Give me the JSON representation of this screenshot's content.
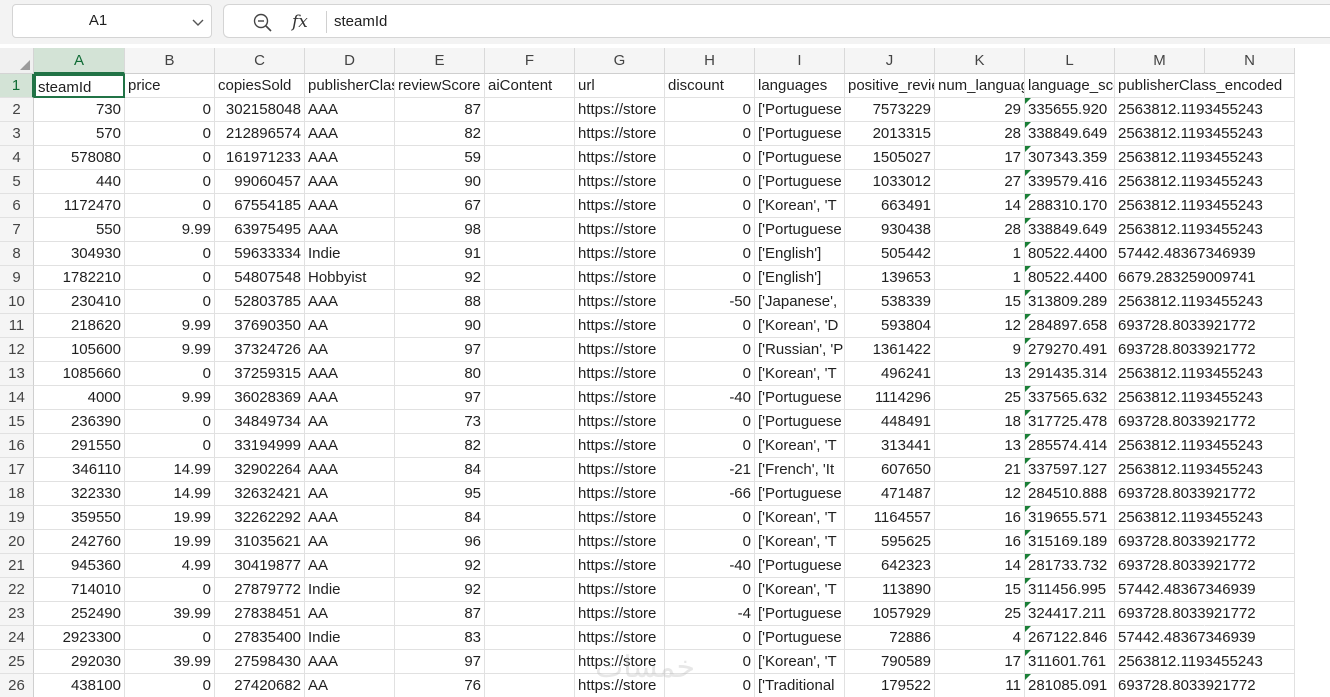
{
  "formula_bar": {
    "name_box": "A1",
    "zoom_icon": "magnifier-icon",
    "fx_label": "fx",
    "value": "steamId"
  },
  "colors": {
    "accent": "#217346",
    "header_bg": "#f5f5f5",
    "selected_header_bg": "#d3e3d6"
  },
  "columns": [
    {
      "letter": "A"
    },
    {
      "letter": "B"
    },
    {
      "letter": "C"
    },
    {
      "letter": "D"
    },
    {
      "letter": "E"
    },
    {
      "letter": "F"
    },
    {
      "letter": "G"
    },
    {
      "letter": "H"
    },
    {
      "letter": "I"
    },
    {
      "letter": "J"
    },
    {
      "letter": "K"
    },
    {
      "letter": "L"
    },
    {
      "letter": "M"
    },
    {
      "letter": "N"
    }
  ],
  "rows": [
    {
      "n": "1",
      "cells": [
        "steamId",
        "price",
        "copiesSold",
        "publisherClass",
        "reviewScore",
        "aiContent",
        "url",
        "discount",
        "languages",
        "positive_reviews",
        "num_languages",
        "language_score",
        "publisherClass_encoded"
      ]
    },
    {
      "n": "2",
      "cells": [
        "730",
        "0",
        "302158048",
        "AAA",
        "87",
        "",
        "https://store",
        "0",
        "['Portuguese",
        "7573229",
        "29",
        "335655.920",
        "2563812.1193455243"
      ]
    },
    {
      "n": "3",
      "cells": [
        "570",
        "0",
        "212896574",
        "AAA",
        "82",
        "",
        "https://store",
        "0",
        "['Portuguese",
        "2013315",
        "28",
        "338849.649",
        "2563812.1193455243"
      ]
    },
    {
      "n": "4",
      "cells": [
        "578080",
        "0",
        "161971233",
        "AAA",
        "59",
        "",
        "https://store",
        "0",
        "['Portuguese",
        "1505027",
        "17",
        "307343.359",
        "2563812.1193455243"
      ]
    },
    {
      "n": "5",
      "cells": [
        "440",
        "0",
        "99060457",
        "AAA",
        "90",
        "",
        "https://store",
        "0",
        "['Portuguese",
        "1033012",
        "27",
        "339579.416",
        "2563812.1193455243"
      ]
    },
    {
      "n": "6",
      "cells": [
        "1172470",
        "0",
        "67554185",
        "AAA",
        "67",
        "",
        "https://store",
        "0",
        "['Korean', 'T",
        "663491",
        "14",
        "288310.170",
        "2563812.1193455243"
      ]
    },
    {
      "n": "7",
      "cells": [
        "550",
        "9.99",
        "63975495",
        "AAA",
        "98",
        "",
        "https://store",
        "0",
        "['Portuguese",
        "930438",
        "28",
        "338849.649",
        "2563812.1193455243"
      ]
    },
    {
      "n": "8",
      "cells": [
        "304930",
        "0",
        "59633334",
        "Indie",
        "91",
        "",
        "https://store",
        "0",
        "['English']",
        "505442",
        "1",
        "80522.4400",
        "57442.48367346939"
      ]
    },
    {
      "n": "9",
      "cells": [
        "1782210",
        "0",
        "54807548",
        "Hobbyist",
        "92",
        "",
        "https://store",
        "0",
        "['English']",
        "139653",
        "1",
        "80522.4400",
        "6679.283259009741"
      ]
    },
    {
      "n": "10",
      "cells": [
        "230410",
        "0",
        "52803785",
        "AAA",
        "88",
        "",
        "https://store",
        "-50",
        "['Japanese',",
        "538339",
        "15",
        "313809.289",
        "2563812.1193455243"
      ]
    },
    {
      "n": "11",
      "cells": [
        "218620",
        "9.99",
        "37690350",
        "AA",
        "90",
        "",
        "https://store",
        "0",
        "['Korean', 'D",
        "593804",
        "12",
        "284897.658",
        "693728.8033921772"
      ]
    },
    {
      "n": "12",
      "cells": [
        "105600",
        "9.99",
        "37324726",
        "AA",
        "97",
        "",
        "https://store",
        "0",
        "['Russian', 'P",
        "1361422",
        "9",
        "279270.491",
        "693728.8033921772"
      ]
    },
    {
      "n": "13",
      "cells": [
        "1085660",
        "0",
        "37259315",
        "AAA",
        "80",
        "",
        "https://store",
        "0",
        "['Korean', 'T",
        "496241",
        "13",
        "291435.314",
        "2563812.1193455243"
      ]
    },
    {
      "n": "14",
      "cells": [
        "4000",
        "9.99",
        "36028369",
        "AAA",
        "97",
        "",
        "https://store",
        "-40",
        "['Portuguese",
        "1114296",
        "25",
        "337565.632",
        "2563812.1193455243"
      ]
    },
    {
      "n": "15",
      "cells": [
        "236390",
        "0",
        "34849734",
        "AA",
        "73",
        "",
        "https://store",
        "0",
        "['Portuguese",
        "448491",
        "18",
        "317725.478",
        "693728.8033921772"
      ]
    },
    {
      "n": "16",
      "cells": [
        "291550",
        "0",
        "33194999",
        "AAA",
        "82",
        "",
        "https://store",
        "0",
        "['Korean', 'T",
        "313441",
        "13",
        "285574.414",
        "2563812.1193455243"
      ]
    },
    {
      "n": "17",
      "cells": [
        "346110",
        "14.99",
        "32902264",
        "AAA",
        "84",
        "",
        "https://store",
        "-21",
        "['French', 'It",
        "607650",
        "21",
        "337597.127",
        "2563812.1193455243"
      ]
    },
    {
      "n": "18",
      "cells": [
        "322330",
        "14.99",
        "32632421",
        "AA",
        "95",
        "",
        "https://store",
        "-66",
        "['Portuguese",
        "471487",
        "12",
        "284510.888",
        "693728.8033921772"
      ]
    },
    {
      "n": "19",
      "cells": [
        "359550",
        "19.99",
        "32262292",
        "AAA",
        "84",
        "",
        "https://store",
        "0",
        "['Korean', 'T",
        "1164557",
        "16",
        "319655.571",
        "2563812.1193455243"
      ]
    },
    {
      "n": "20",
      "cells": [
        "242760",
        "19.99",
        "31035621",
        "AA",
        "96",
        "",
        "https://store",
        "0",
        "['Korean', 'T",
        "595625",
        "16",
        "315169.189",
        "693728.8033921772"
      ]
    },
    {
      "n": "21",
      "cells": [
        "945360",
        "4.99",
        "30419877",
        "AA",
        "92",
        "",
        "https://store",
        "-40",
        "['Portuguese",
        "642323",
        "14",
        "281733.732",
        "693728.8033921772"
      ]
    },
    {
      "n": "22",
      "cells": [
        "714010",
        "0",
        "27879772",
        "Indie",
        "92",
        "",
        "https://store",
        "0",
        "['Korean', 'T",
        "113890",
        "15",
        "311456.995",
        "57442.48367346939"
      ]
    },
    {
      "n": "23",
      "cells": [
        "252490",
        "39.99",
        "27838451",
        "AA",
        "87",
        "",
        "https://store",
        "-4",
        "['Portuguese",
        "1057929",
        "25",
        "324417.211",
        "693728.8033921772"
      ]
    },
    {
      "n": "24",
      "cells": [
        "2923300",
        "0",
        "27835400",
        "Indie",
        "83",
        "",
        "https://store",
        "0",
        "['Portuguese",
        "72886",
        "4",
        "267122.846",
        "57442.48367346939"
      ]
    },
    {
      "n": "25",
      "cells": [
        "292030",
        "39.99",
        "27598430",
        "AAA",
        "97",
        "",
        "https://store",
        "0",
        "['Korean', 'T",
        "790589",
        "17",
        "311601.761",
        "2563812.1193455243"
      ]
    },
    {
      "n": "26",
      "cells": [
        "438100",
        "0",
        "27420682",
        "AA",
        "76",
        "",
        "https://store",
        "0",
        "['Traditional",
        "179522",
        "11",
        "281085.091",
        "693728.8033921772"
      ]
    }
  ],
  "watermark": "خمسات"
}
